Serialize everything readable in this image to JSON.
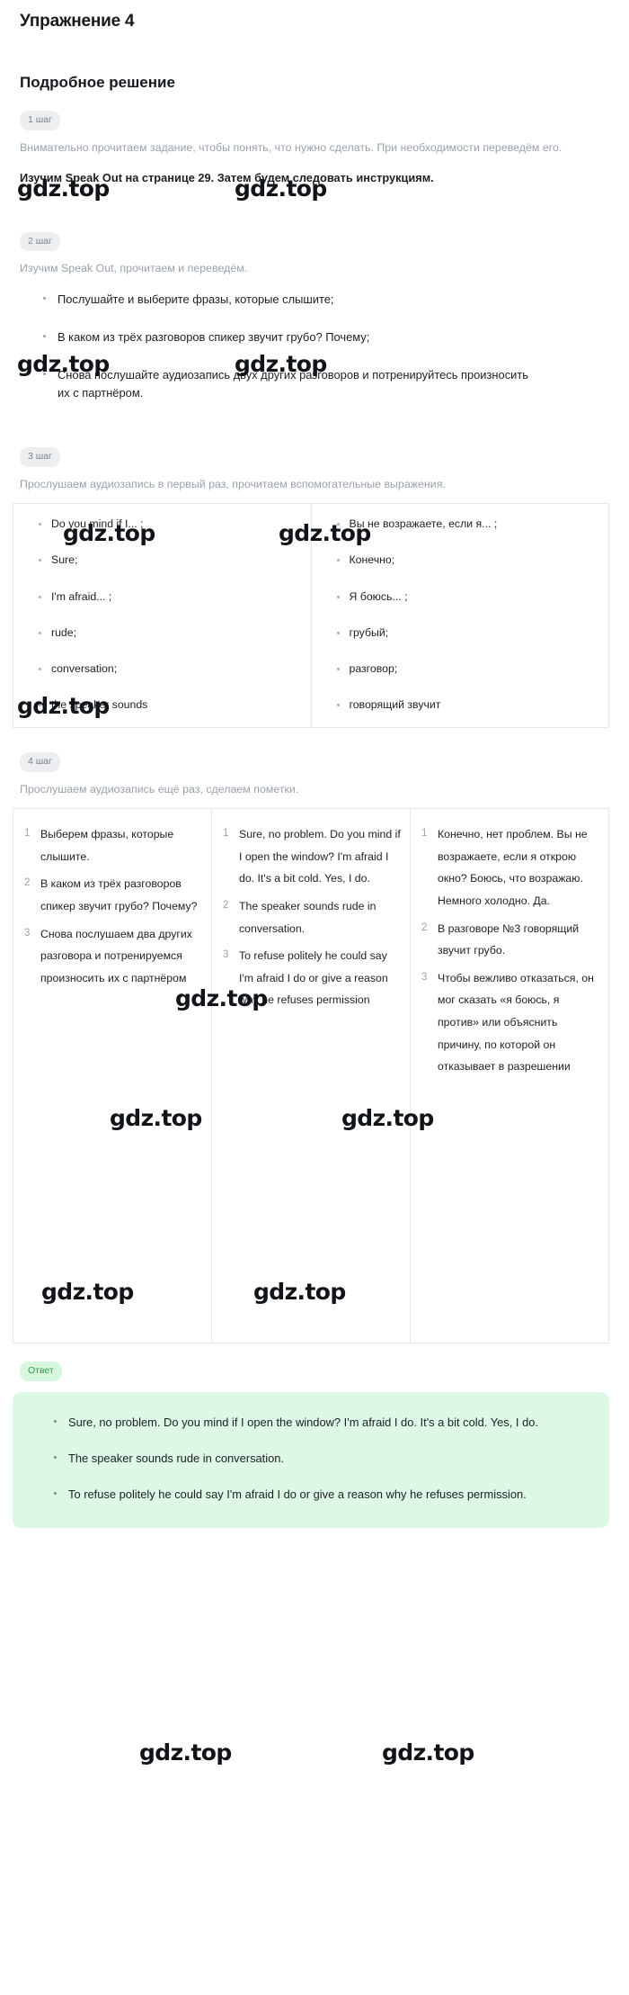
{
  "header": {
    "exercise_title": "Упражнение 4",
    "solution_title": "Подробное решение"
  },
  "watermark": {
    "text": "gdz.top"
  },
  "steps": [
    {
      "chip": "1 шаг",
      "muted_text": "Внимательно прочитаем задание, чтобы понять, что нужно сделать. При необходимости переведём его.",
      "dark_text": "Изучим Speak Out на странице 29. Затем будем следовать инструкциям."
    },
    {
      "chip": "2 шаг",
      "muted_text": "Изучим Speak Out, прочитаем и переведём.",
      "bullets": [
        "Послушайте и выберите фразы, которые слышите;",
        "В каком из трёх разговоров спикер звучит грубо? Почему;",
        "Снова послушайте аудиозапись двух других разговоров и потренируйтесь произносить их с партнёром."
      ]
    },
    {
      "chip": "3 шаг",
      "muted_text": "Прослушаем аудиозапись в первый раз, прочитаем вспомогательные выражения.",
      "table": {
        "english": [
          "Do you mind if I... ;",
          "Sure;",
          "I'm afraid... ;",
          "rude;",
          "conversation;",
          "the speaker sounds"
        ],
        "russian": [
          "Вы не возражаете, если я... ;",
          "Конечно;",
          "Я боюсь... ;",
          "грубый;",
          "разговор;",
          "говорящий звучит"
        ]
      }
    },
    {
      "chip": "4 шаг",
      "muted_text": "Прослушаем аудиозапись ещё раз, сделаем пометки.",
      "table": {
        "col1": [
          "Выберем фразы, которые слышите.",
          "В каком из трёх разговоров спикер звучит грубо? Почему?",
          "Снова послушаем два других разговора и потренируемся произносить их с партнёром"
        ],
        "col2": [
          "Sure, no problem. Do you mind if I open the window? I'm afraid I do. It's a bit cold. Yes, I do.",
          "The speaker sounds rude in conversation.",
          "To refuse politely he could say I'm afraid I do or give a reason why he refuses permission"
        ],
        "col3": [
          "Конечно, нет проблем. Вы не возражаете, если я открою окно? Боюсь, что возражаю. Немного холодно. Да.",
          "В разговоре №3 говорящий звучит грубо.",
          "Чтобы вежливо отказаться, он мог сказать «я боюсь, я против» или объяснить причину, по которой он отказывает в разрешении"
        ]
      }
    }
  ],
  "answer": {
    "chip": "Ответ",
    "bullets": [
      "Sure, no problem. Do you mind if I open the window? I'm afraid I do. It's a bit cold. Yes, I do.",
      "The speaker sounds rude in conversation.",
      "To refuse politely he could say I'm afraid I do or give a reason why he refuses permission."
    ]
  },
  "colors": {
    "answer_bg": "#ddf8e4",
    "answer_chip_bg": "#d6f7de",
    "answer_chip_text": "#2e9d51",
    "chip_bg": "#eceef0",
    "muted_text": "#9aa1ab",
    "border": "#e6e8eb"
  }
}
